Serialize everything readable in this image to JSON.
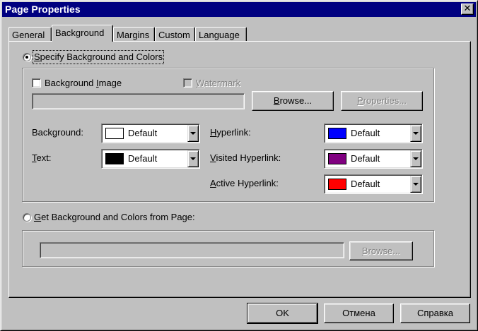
{
  "window": {
    "title": "Page Properties",
    "close_glyph": "✕"
  },
  "tabs": [
    {
      "label": "General"
    },
    {
      "label": "Background",
      "active": true
    },
    {
      "label": "Margins"
    },
    {
      "label": "Custom"
    },
    {
      "label": "Language"
    }
  ],
  "specify": {
    "label": "Specify Background and Colors",
    "selected": true,
    "background_image_label": "Background Image",
    "watermark_label": "Watermark",
    "image_path_value": "",
    "browse_label": "Browse...",
    "properties_label": "Properties..."
  },
  "colors": {
    "background": {
      "label": "Background:",
      "value": "Default",
      "swatch": "#ffffff"
    },
    "text": {
      "label": "Text:",
      "value": "Default",
      "swatch": "#000000"
    },
    "hyperlink": {
      "label": "Hyperlink:",
      "value": "Default",
      "swatch": "#0000ff"
    },
    "visited": {
      "label": "Visited Hyperlink:",
      "value": "Default",
      "swatch": "#800080"
    },
    "active": {
      "label": "Active Hyperlink:",
      "value": "Default",
      "swatch": "#ff0000"
    }
  },
  "from_page": {
    "label": "Get Background and Colors from Page:",
    "selected": false,
    "path_value": "",
    "browse_label": "Browse..."
  },
  "footer": {
    "ok_label": "OK",
    "cancel_label": "Отмена",
    "help_label": "Справка"
  }
}
